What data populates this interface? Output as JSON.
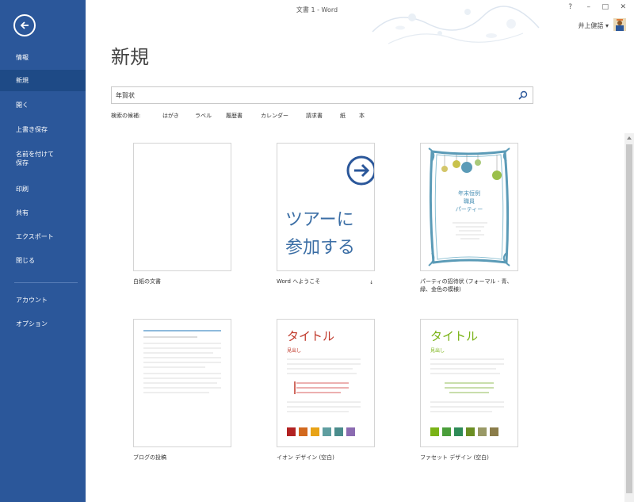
{
  "window": {
    "title": "文書 1 - Word",
    "help": "?",
    "minimize": "–",
    "maximize": "□",
    "close": "✕"
  },
  "user": {
    "name": "井上健語 ▾"
  },
  "sidebar": {
    "items": [
      {
        "label": "情報"
      },
      {
        "label": "新規"
      },
      {
        "label": "開く"
      },
      {
        "label": "上書き保存"
      },
      {
        "label": "名前を付けて\n保存"
      },
      {
        "label": "印刷"
      },
      {
        "label": "共有"
      },
      {
        "label": "エクスポート"
      },
      {
        "label": "閉じる"
      },
      {
        "label": "アカウント"
      },
      {
        "label": "オプション"
      }
    ]
  },
  "main": {
    "title": "新規",
    "search": {
      "value": "年賀状",
      "placeholder": ""
    },
    "suggested_label": "検索の候補:",
    "suggested": [
      "はがき",
      "ラベル",
      "履歴書",
      "カレンダー",
      "請求書",
      "紙",
      "本"
    ],
    "templates": [
      {
        "label": "白紙の文書"
      },
      {
        "label": "Word へようこそ",
        "overlay_text": [
          "ツアーに",
          "参加する"
        ],
        "pin": "↓"
      },
      {
        "label": "パーティの招待状 (フォーマル - 青、緑、金色の模様)",
        "card_lines": [
          "年末恒例",
          "職員",
          "パーティー"
        ]
      },
      {
        "label": "ブログの投稿"
      },
      {
        "label": "イオン デザイン (空白)",
        "heading": "タイトル",
        "subheading": "見出し",
        "swatches": [
          "#b22222",
          "#d2691e",
          "#e8a317",
          "#5f9ea0",
          "#4a8c8c",
          "#8b6bb1"
        ]
      },
      {
        "label": "ファセット デザイン (空白)",
        "heading": "タイトル",
        "subheading": "見出し",
        "swatches": [
          "#7ab317",
          "#4a9e3a",
          "#2e8b57",
          "#6b8e23",
          "#999966",
          "#8b7d4a"
        ]
      }
    ]
  },
  "colors": {
    "accent": "#2b579a"
  }
}
